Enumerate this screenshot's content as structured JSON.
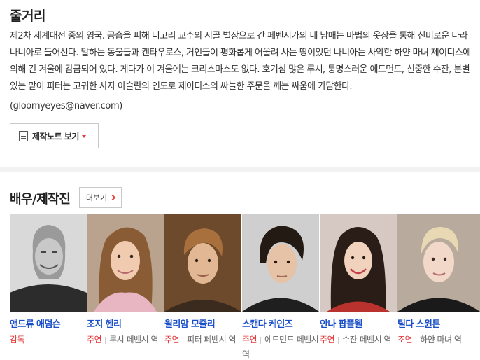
{
  "plot": {
    "title": "줄거리",
    "text": "제2차 세계대전 중의 영국. 공습을 피해 디고리 교수의 시골 별장으로 간 페벤시가의 네 남매는 마법의 옷장을 통해 신비로운 나라 나니아로 들어선다. 말하는 동물들과 켄타우로스, 거인들이 평화롭게 어울려 사는 땅이었던 나니아는 사악한 하얀 마녀 제이디스에 의해 긴 겨울에 감금되어 있다. 게다가 이 겨울에는 크리스마스도 없다. 호기심 많은 루시, 퉁명스러운 에드먼드, 신중한 수잔, 분별 있는 맏이 피터는 고귀한 사자 아슬란의 인도로 제이디스의 싸늘한 주문을 깨는 싸움에 가담한다.",
    "source": "(gloomyeyes@naver.com)",
    "note_button_label": "제작노트 보기"
  },
  "cast": {
    "title": "배우/제작진",
    "more_label": "더보기",
    "colors": {
      "name": "#1a4fc9",
      "role_type": "#e63b3b",
      "accent": "#e63b3b"
    },
    "members": [
      {
        "name": "앤드류 애덤슨",
        "role_type": "감독",
        "role": ""
      },
      {
        "name": "조지 헨리",
        "role_type": "주연",
        "role": "루시 페벤시 역"
      },
      {
        "name": "윌리암 모즐리",
        "role_type": "주연",
        "role": "피터 페벤시 역"
      },
      {
        "name": "스캔다 케인즈",
        "role_type": "주연",
        "role": "에드먼드 페벤시 역"
      },
      {
        "name": "안나 팝플웰",
        "role_type": "주연",
        "role": "수잔 페벤시 역"
      },
      {
        "name": "틸다 스윈튼",
        "role_type": "조연",
        "role": "하얀 마녀 역"
      }
    ]
  }
}
